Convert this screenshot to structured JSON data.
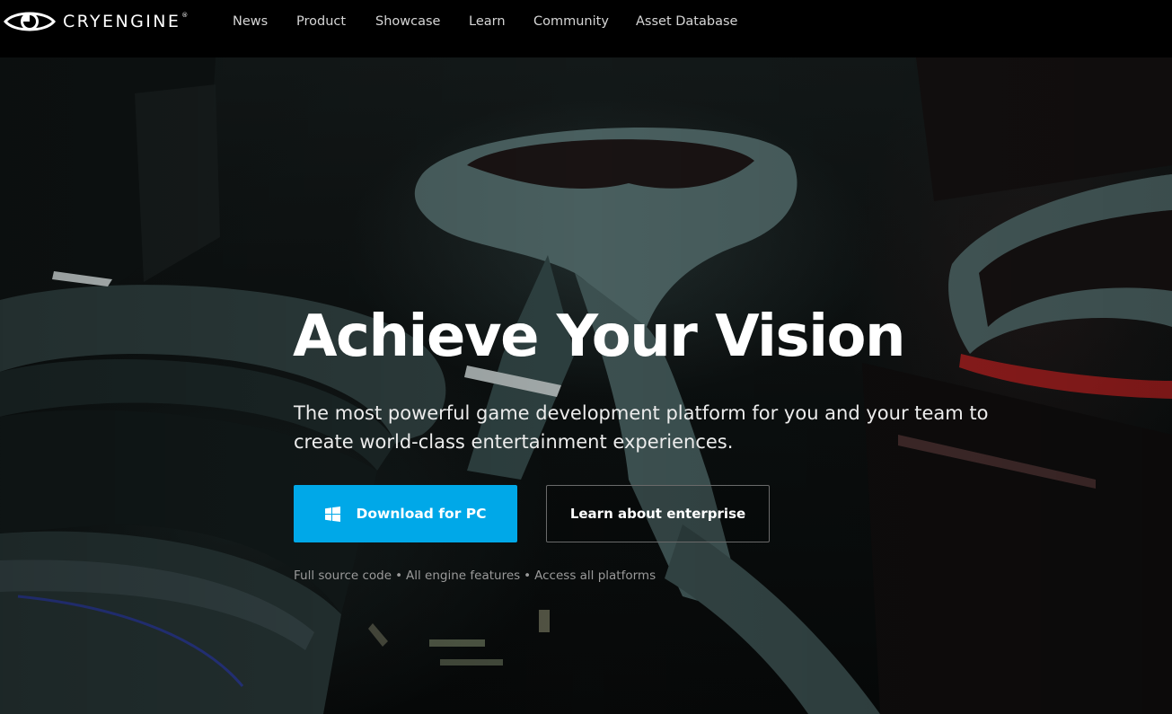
{
  "header": {
    "logo_text": "CRYENGINE",
    "logo_registered": "®",
    "nav": [
      {
        "label": "News"
      },
      {
        "label": "Product"
      },
      {
        "label": "Showcase"
      },
      {
        "label": "Learn"
      },
      {
        "label": "Community"
      },
      {
        "label": "Asset Database"
      }
    ]
  },
  "hero": {
    "headline": "Achieve Your Vision",
    "subtext": "The most powerful game development platform for you and your team to create world-class entertainment experiences.",
    "primary_button": {
      "label": "Download for PC",
      "icon": "windows-icon"
    },
    "secondary_button": {
      "label": "Learn about enterprise"
    },
    "features": [
      "Full source code",
      "All engine features",
      "Access all platforms"
    ],
    "feature_separator": "•"
  },
  "colors": {
    "nav_bg": "#000000",
    "primary_button": "#00a8e8",
    "headline": "#ffffff",
    "nav_text": "#d6d6d6",
    "features_text": "#9a9a9a"
  }
}
